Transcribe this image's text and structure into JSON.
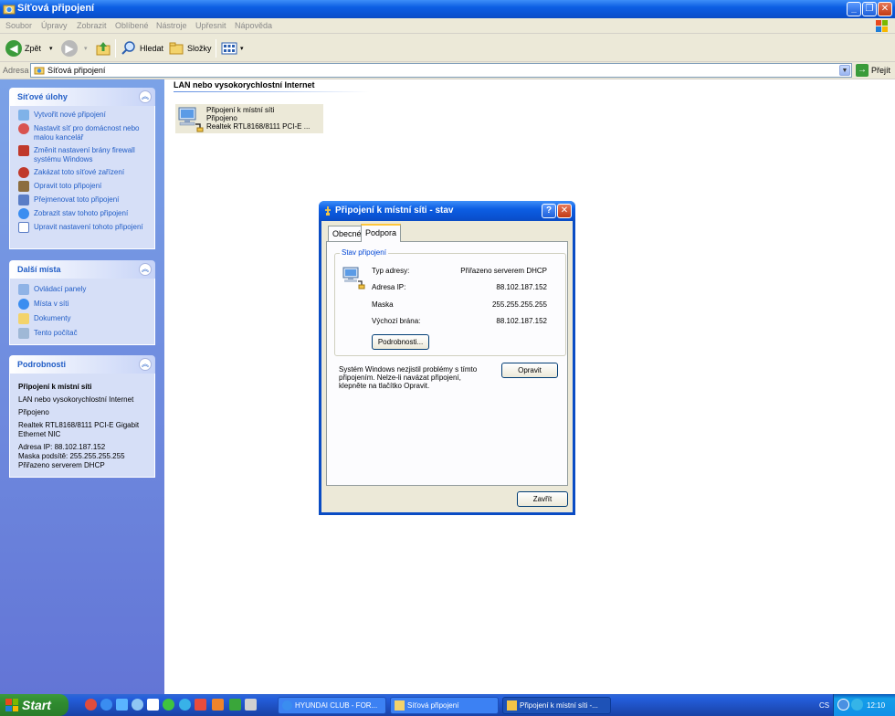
{
  "window": {
    "title": "Síťová připojení",
    "min": "_",
    "max": "❐",
    "close": "✕"
  },
  "menu": [
    "Soubor",
    "Úpravy",
    "Zobrazit",
    "Oblíbené",
    "Nástroje",
    "Upřesnit",
    "Nápověda"
  ],
  "toolbar": {
    "back": "Zpět",
    "search": "Hledat",
    "folders": "Složky"
  },
  "address": {
    "label": "Adresa",
    "value": "Síťová připojení",
    "go": "Přejít"
  },
  "sidebar": {
    "tasks": {
      "title": "Síťové úlohy",
      "items": [
        "Vytvořit nové připojení",
        "Nastavit síť pro domácnost nebo malou kancelář",
        "Změnit nastavení brány firewall systému Windows",
        "Zakázat toto síťové zařízení",
        "Opravit toto připojení",
        "Přejmenovat toto připojení",
        "Zobrazit stav tohoto připojení",
        "Upravit nastavení tohoto připojení"
      ]
    },
    "places": {
      "title": "Další místa",
      "items": [
        "Ovládací panely",
        "Místa v síti",
        "Dokumenty",
        "Tento počítač"
      ]
    },
    "details": {
      "title": "Podrobnosti",
      "name": "Připojení k místní síti",
      "type": "LAN nebo vysokorychlostní Internet",
      "status": "Připojeno",
      "adapter": "Realtek RTL8168/8111 PCI-E Gigabit Ethernet NIC",
      "ip": "Adresa IP: 88.102.187.152",
      "mask": "Maska podsítě: 255.255.255.255",
      "assigned": "Přiřazeno serverem DHCP"
    }
  },
  "content": {
    "group_header": "LAN nebo vysokorychlostní Internet",
    "connection": {
      "name": "Připojení k místní síti",
      "status": "Připojeno",
      "adapter": "Realtek RTL8168/8111 PCI-E ..."
    }
  },
  "dialog": {
    "title": "Připojení k místní síti - stav",
    "help": "?",
    "close": "✕",
    "tabs": [
      "Obecné",
      "Podpora"
    ],
    "group_label": "Stav připojení",
    "rows": [
      {
        "label": "Typ adresy:",
        "value": "Přiřazeno serverem DHCP"
      },
      {
        "label": "Adresa IP:",
        "value": "88.102.187.152"
      },
      {
        "label": "Maska",
        "value": "255.255.255.255"
      },
      {
        "label": "Výchozí brána:",
        "value": "88.102.187.152"
      }
    ],
    "details_button": "Podrobnosti...",
    "message": "Systém Windows nezjistil problémy s tímto připojením. Nelze-li navázat připojení, klepněte na tlačítko Opravit.",
    "repair_button": "Opravit",
    "close_button": "Zavřít"
  },
  "taskbar": {
    "start": "Start",
    "buttons": [
      "HYUNDAI CLUB - FOR...",
      "Síťová připojení",
      "Připojení k místní síti -..."
    ],
    "lang": "CS",
    "time": "12:10"
  },
  "colors": {
    "xp_blue": "#0a52d2",
    "sidebar_link": "#215dc6",
    "dialog_face": "#ece9d8",
    "start_green": "#2f8b2f"
  }
}
